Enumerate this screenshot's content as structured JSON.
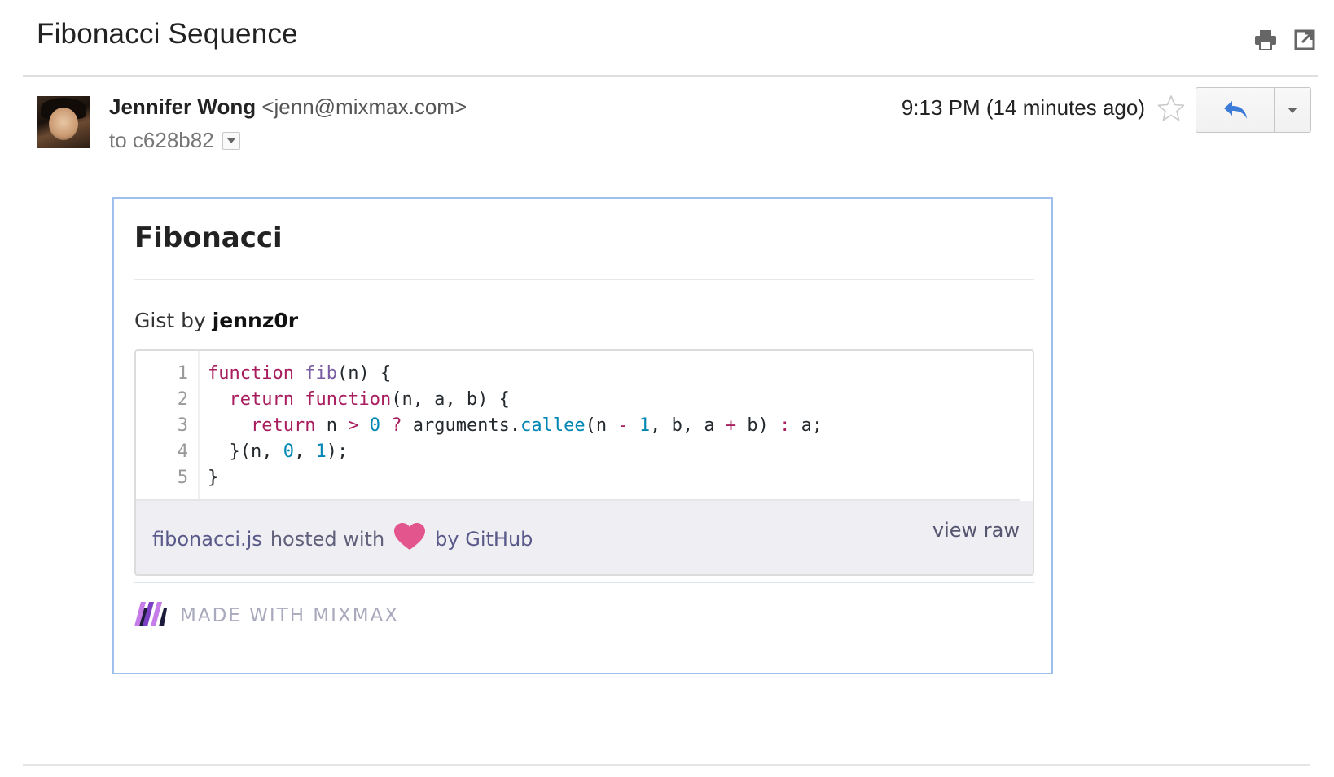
{
  "header": {
    "subject": "Fibonacci Sequence",
    "icons": [
      "print-icon",
      "open-in-new-window-icon"
    ]
  },
  "message": {
    "sender_name": "Jennifer Wong",
    "sender_email": "<jenn@mixmax.com>",
    "to_label": "to c628b82",
    "timestamp": "9:13 PM (14 minutes ago)"
  },
  "card": {
    "title": "Fibonacci",
    "gist_by_prefix": "Gist by ",
    "gist_author": "jennz0r",
    "code_lines": [
      "function fib(n) {",
      "  return function(n, a, b) {",
      "    return n > 0 ? arguments.callee(n - 1, b, a + b) : a;",
      "  }(n, 0, 1);",
      "}"
    ],
    "line_numbers": [
      "1",
      "2",
      "3",
      "4",
      "5"
    ],
    "footer_file": "fibonacci.js",
    "footer_hosted": "hosted with",
    "footer_by": "by GitHub",
    "view_raw": "view raw",
    "made_with": "MADE WITH MIXMAX"
  },
  "colors": {
    "card_border": "#9fc0ec",
    "reply_arrow": "#3d7bd9",
    "heart": "#e2558d",
    "keyword": "#a71d5d",
    "function_name": "#795da3",
    "number": "#0086b3"
  }
}
